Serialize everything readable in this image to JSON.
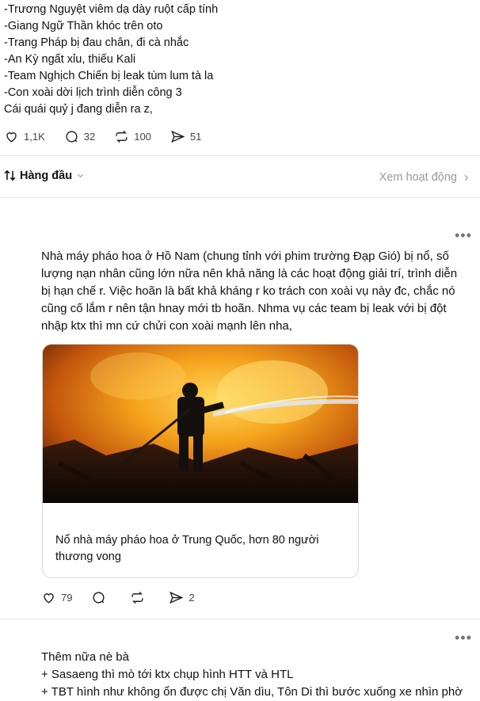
{
  "post_top": {
    "lines": [
      "-Trương Nguyệt viêm dạ dày ruột cấp tính",
      "-Giang Ngữ Thần khóc trên oto",
      "-Trang Pháp bị đau chân, đi cà nhắc",
      "-An Kỳ ngất xỉu, thiếu Kali",
      "-Team Nghịch Chiến bị leak tùm lum tà la",
      "-Con xoài dời lịch trình diễn công 3",
      "Cái quái quỷ j đang diễn ra z,"
    ],
    "likes": "1,1K",
    "comments": "32",
    "reposts": "100",
    "shares": "51"
  },
  "sort_bar": {
    "sort_label": "Hàng đầu",
    "view_activity": "Xem hoạt động"
  },
  "reply1": {
    "text": "Nhà máy pháo hoa ở Hồ Nam (chung tỉnh với phim trường Đạp Gió) bị nổ, số lượng nạn nhân cũng lớn nữa nên khả năng là các hoạt động giải trí, trình diễn bị hạn chế r. Việc hoãn là bất khả kháng r ko trách con xoài vụ này đc, chắc nó cũng cố lắm r nên tận hnay mới tb hoãn. Nhma vụ các team bị leak với bị đột nhập ktx thì mn cứ chửi con xoài mạnh lên nha,",
    "link_title": "Nổ nhà máy pháo hoa ở Trung Quốc, hơn 80 người thương vong",
    "likes": "79",
    "shares": "2"
  },
  "reply2": {
    "lines": [
      "Thêm nữa nè bà",
      "+ Sasaeng thì mò tới ktx chụp hình HTT và HTL",
      "+ TBT hình như không ổn được chị Văn dìu, Tôn Di thì bước xuống xe nhìn phờ"
    ]
  },
  "icons": [
    "heart-icon",
    "comment-icon",
    "repost-icon",
    "share-icon",
    "sort-icon",
    "chevron-down-icon",
    "chevron-right-icon",
    "more-icon"
  ]
}
